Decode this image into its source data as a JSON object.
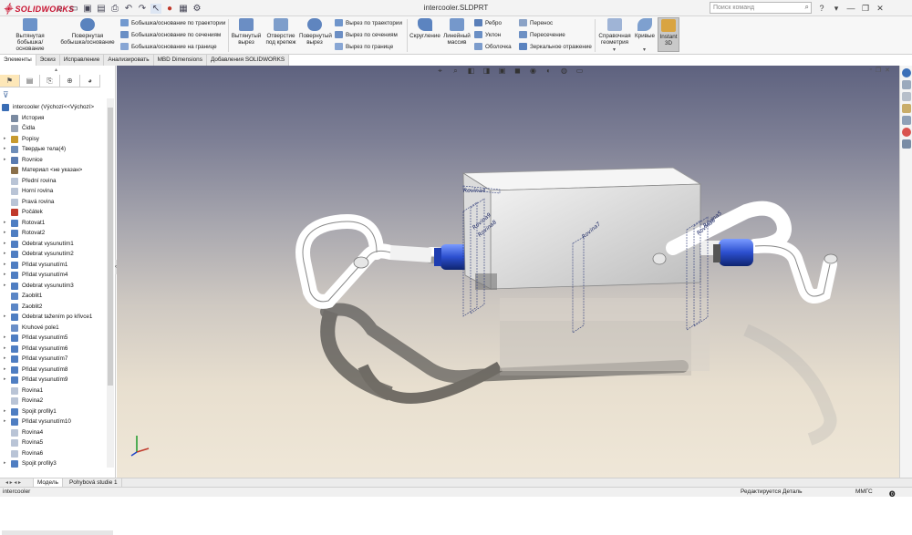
{
  "app": {
    "logo_text": "SOLIDWORKS",
    "window_title": "intercooler.SLDPRT",
    "search_placeholder": "Поиск команд"
  },
  "ribbon": {
    "extrude_boss": "Вытянутая бобышка/основание",
    "revolve_boss": "Повернутая бобышка/основание",
    "sweep_boss": "Бобышка/основание по траектории",
    "loft_boss": "Бобышка/основание по сечениям",
    "boundary_boss": "Бобышка/основание на границе",
    "extrude_cut": "Вытянутый вырез",
    "hole_wizard": "Отверстие под крепеж",
    "revolve_cut": "Повернутый вырез",
    "sweep_cut": "Вырез по траектории",
    "loft_cut": "Вырез по сечениям",
    "boundary_cut": "Вырез по границе",
    "fillet": "Скругление",
    "linear_pattern": "Линейный массив",
    "rib": "Ребро",
    "draft": "Уклон",
    "shell": "Оболочка",
    "wrap": "Перенос",
    "intersect": "Пересечение",
    "mirror": "Зеркальное отражение",
    "ref_geometry": "Справочная геометрия",
    "curves": "Кривые",
    "instant3d": "Instant 3D"
  },
  "tabs": [
    "Элементы",
    "Эскиз",
    "Исправление",
    "Анализировать",
    "MBD Dimensions",
    "Добавления SOLIDWORKS"
  ],
  "tree": [
    {
      "label": "intercooler  (Výchozí<<Výchozí>",
      "color": "#3a6db5",
      "arrow": false,
      "indent": 0
    },
    {
      "label": "История",
      "color": "#7a8aa0",
      "arrow": false,
      "indent": 1
    },
    {
      "label": "Čidla",
      "color": "#9aa5b5",
      "arrow": false,
      "indent": 1
    },
    {
      "label": "Popisy",
      "color": "#c79a2e",
      "arrow": true,
      "indent": 1
    },
    {
      "label": "Твердые тела(4)",
      "color": "#6e8db8",
      "arrow": true,
      "indent": 1
    },
    {
      "label": "Rovnice",
      "color": "#5a7bb0",
      "arrow": true,
      "indent": 1
    },
    {
      "label": "Материал <не указан>",
      "color": "#8a6f4a",
      "arrow": false,
      "indent": 1
    },
    {
      "label": "Přední rovina",
      "color": "#b9c4d6",
      "arrow": false,
      "indent": 1
    },
    {
      "label": "Horní rovina",
      "color": "#b9c4d6",
      "arrow": false,
      "indent": 1
    },
    {
      "label": "Pravá rovina",
      "color": "#b9c4d6",
      "arrow": false,
      "indent": 1
    },
    {
      "label": "Počátek",
      "color": "#c0392b",
      "arrow": false,
      "indent": 1
    },
    {
      "label": "Rotovat1",
      "color": "#4f7ec2",
      "arrow": true,
      "indent": 1
    },
    {
      "label": "Rotovat2",
      "color": "#4f7ec2",
      "arrow": true,
      "indent": 1
    },
    {
      "label": "Odebrat vysunutím1",
      "color": "#4f7ec2",
      "arrow": true,
      "indent": 1
    },
    {
      "label": "Odebrat vysunutím2",
      "color": "#4f7ec2",
      "arrow": true,
      "indent": 1
    },
    {
      "label": "Přidat vysunutím1",
      "color": "#4f7ec2",
      "arrow": true,
      "indent": 1
    },
    {
      "label": "Přidat vysunutím4",
      "color": "#4f7ec2",
      "arrow": true,
      "indent": 1
    },
    {
      "label": "Odebrat vysunutím3",
      "color": "#4f7ec2",
      "arrow": true,
      "indent": 1
    },
    {
      "label": "Zaoblit1",
      "color": "#5b86c6",
      "arrow": false,
      "indent": 1
    },
    {
      "label": "Zaoblit2",
      "color": "#5b86c6",
      "arrow": false,
      "indent": 1
    },
    {
      "label": "Odebrat tažením po křivce1",
      "color": "#4f7ec2",
      "arrow": true,
      "indent": 1
    },
    {
      "label": "Kruhové pole1",
      "color": "#6a8fc8",
      "arrow": false,
      "indent": 1
    },
    {
      "label": "Přidat vysunutím5",
      "color": "#4f7ec2",
      "arrow": true,
      "indent": 1
    },
    {
      "label": "Přidat vysunutím6",
      "color": "#4f7ec2",
      "arrow": true,
      "indent": 1
    },
    {
      "label": "Přidat vysunutím7",
      "color": "#4f7ec2",
      "arrow": true,
      "indent": 1
    },
    {
      "label": "Přidat vysunutím8",
      "color": "#4f7ec2",
      "arrow": true,
      "indent": 1
    },
    {
      "label": "Přidat vysunutím9",
      "color": "#4f7ec2",
      "arrow": true,
      "indent": 1
    },
    {
      "label": "Rovina1",
      "color": "#b9c4d6",
      "arrow": false,
      "indent": 1
    },
    {
      "label": "Rovina2",
      "color": "#b9c4d6",
      "arrow": false,
      "indent": 1
    },
    {
      "label": "Spojit profily1",
      "color": "#4f7ec2",
      "arrow": true,
      "indent": 1
    },
    {
      "label": "Přidat vysunutím10",
      "color": "#4f7ec2",
      "arrow": true,
      "indent": 1
    },
    {
      "label": "Rovina4",
      "color": "#b9c4d6",
      "arrow": false,
      "indent": 1
    },
    {
      "label": "Rovina5",
      "color": "#b9c4d6",
      "arrow": false,
      "indent": 1
    },
    {
      "label": "Rovina6",
      "color": "#b9c4d6",
      "arrow": false,
      "indent": 1
    },
    {
      "label": "Spojit profily3",
      "color": "#4f7ec2",
      "arrow": true,
      "indent": 1
    }
  ],
  "viewport": {
    "plane_labels": [
      "Rovina9",
      "Rovina8",
      "Rovina7",
      "Rovina6",
      "Rovina5",
      "Rovina4"
    ]
  },
  "bottom_tabs": [
    "Модель",
    "Pohybová studie 1"
  ],
  "status": {
    "doc": "intercooler",
    "editing": "Редактируется Деталь",
    "units": "ММГС"
  }
}
